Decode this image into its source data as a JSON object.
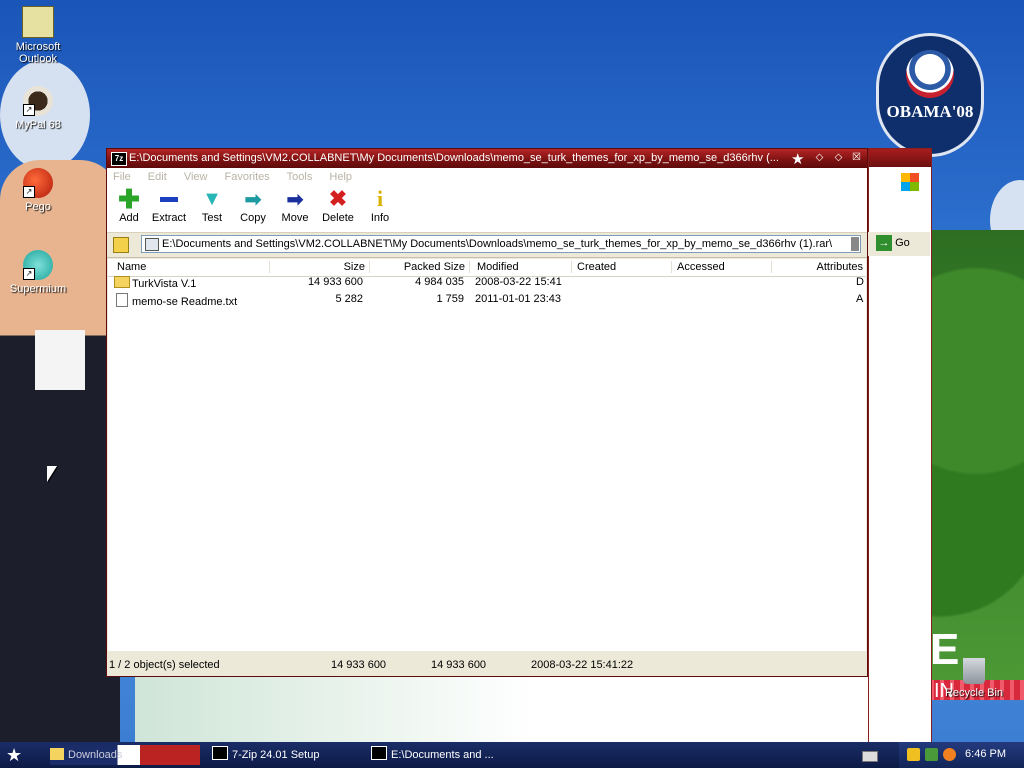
{
  "desktop": {
    "icons": [
      {
        "label": "Microsoft Outlook"
      },
      {
        "label": "MyPal 68"
      },
      {
        "label": "Pego"
      },
      {
        "label": "Supermium"
      }
    ],
    "recycle_bin": "Recycle Bin",
    "wallpaper_text": {
      "obama": "OBAMA'08",
      "big_e": "E",
      "big_in": "IN"
    }
  },
  "window": {
    "title": "E:\\Documents and Settings\\VM2.COLLABNET\\My Documents\\Downloads\\memo_se_turk_themes_for_xp_by_memo_se_d366rhv (...",
    "app_icon": "7z",
    "menu": [
      "File",
      "Edit",
      "View",
      "Favorites",
      "Tools",
      "Help"
    ],
    "toolbar": [
      {
        "label": "Add",
        "icon": "plus-icon",
        "color": "#2aa52a"
      },
      {
        "label": "Extract",
        "icon": "minus-icon",
        "color": "#1a3fbf"
      },
      {
        "label": "Test",
        "icon": "check-icon",
        "color": "#27b5b5"
      },
      {
        "label": "Copy",
        "icon": "copy-arrow-icon",
        "color": "#1c9aa0"
      },
      {
        "label": "Move",
        "icon": "move-arrow-icon",
        "color": "#1a2e9e"
      },
      {
        "label": "Delete",
        "icon": "x-icon",
        "color": "#d41f1f"
      },
      {
        "label": "Info",
        "icon": "info-icon",
        "color": "#d9b200"
      }
    ],
    "address": "E:\\Documents and Settings\\VM2.COLLABNET\\My Documents\\Downloads\\memo_se_turk_themes_for_xp_by_memo_se_d366rhv (1).rar\\",
    "columns": [
      "Name",
      "Size",
      "Packed Size",
      "Modified",
      "Created",
      "Accessed",
      "Attributes"
    ],
    "rows": [
      {
        "name": "TurkVista V.1",
        "size": "14 933 600",
        "packed": "4 984 035",
        "modified": "2008-03-22 15:41",
        "created": "",
        "accessed": "",
        "attr": "D",
        "type": "folder"
      },
      {
        "name": "memo-se Readme.txt",
        "size": "5 282",
        "packed": "1 759",
        "modified": "2011-01-01 23:43",
        "created": "",
        "accessed": "",
        "attr": "A",
        "type": "text"
      }
    ],
    "status": {
      "selection": "1 / 2 object(s) selected",
      "size": "14 933 600",
      "packed": "14 933 600",
      "date": "2008-03-22 15:41:22"
    }
  },
  "background_window": {
    "go_label": "Go"
  },
  "taskbar": {
    "items": [
      {
        "label": "Downloads"
      },
      {
        "label": "7-Zip 24.01 Setup"
      },
      {
        "label": "E:\\Documents and ..."
      }
    ],
    "clock": "6:46 PM"
  }
}
